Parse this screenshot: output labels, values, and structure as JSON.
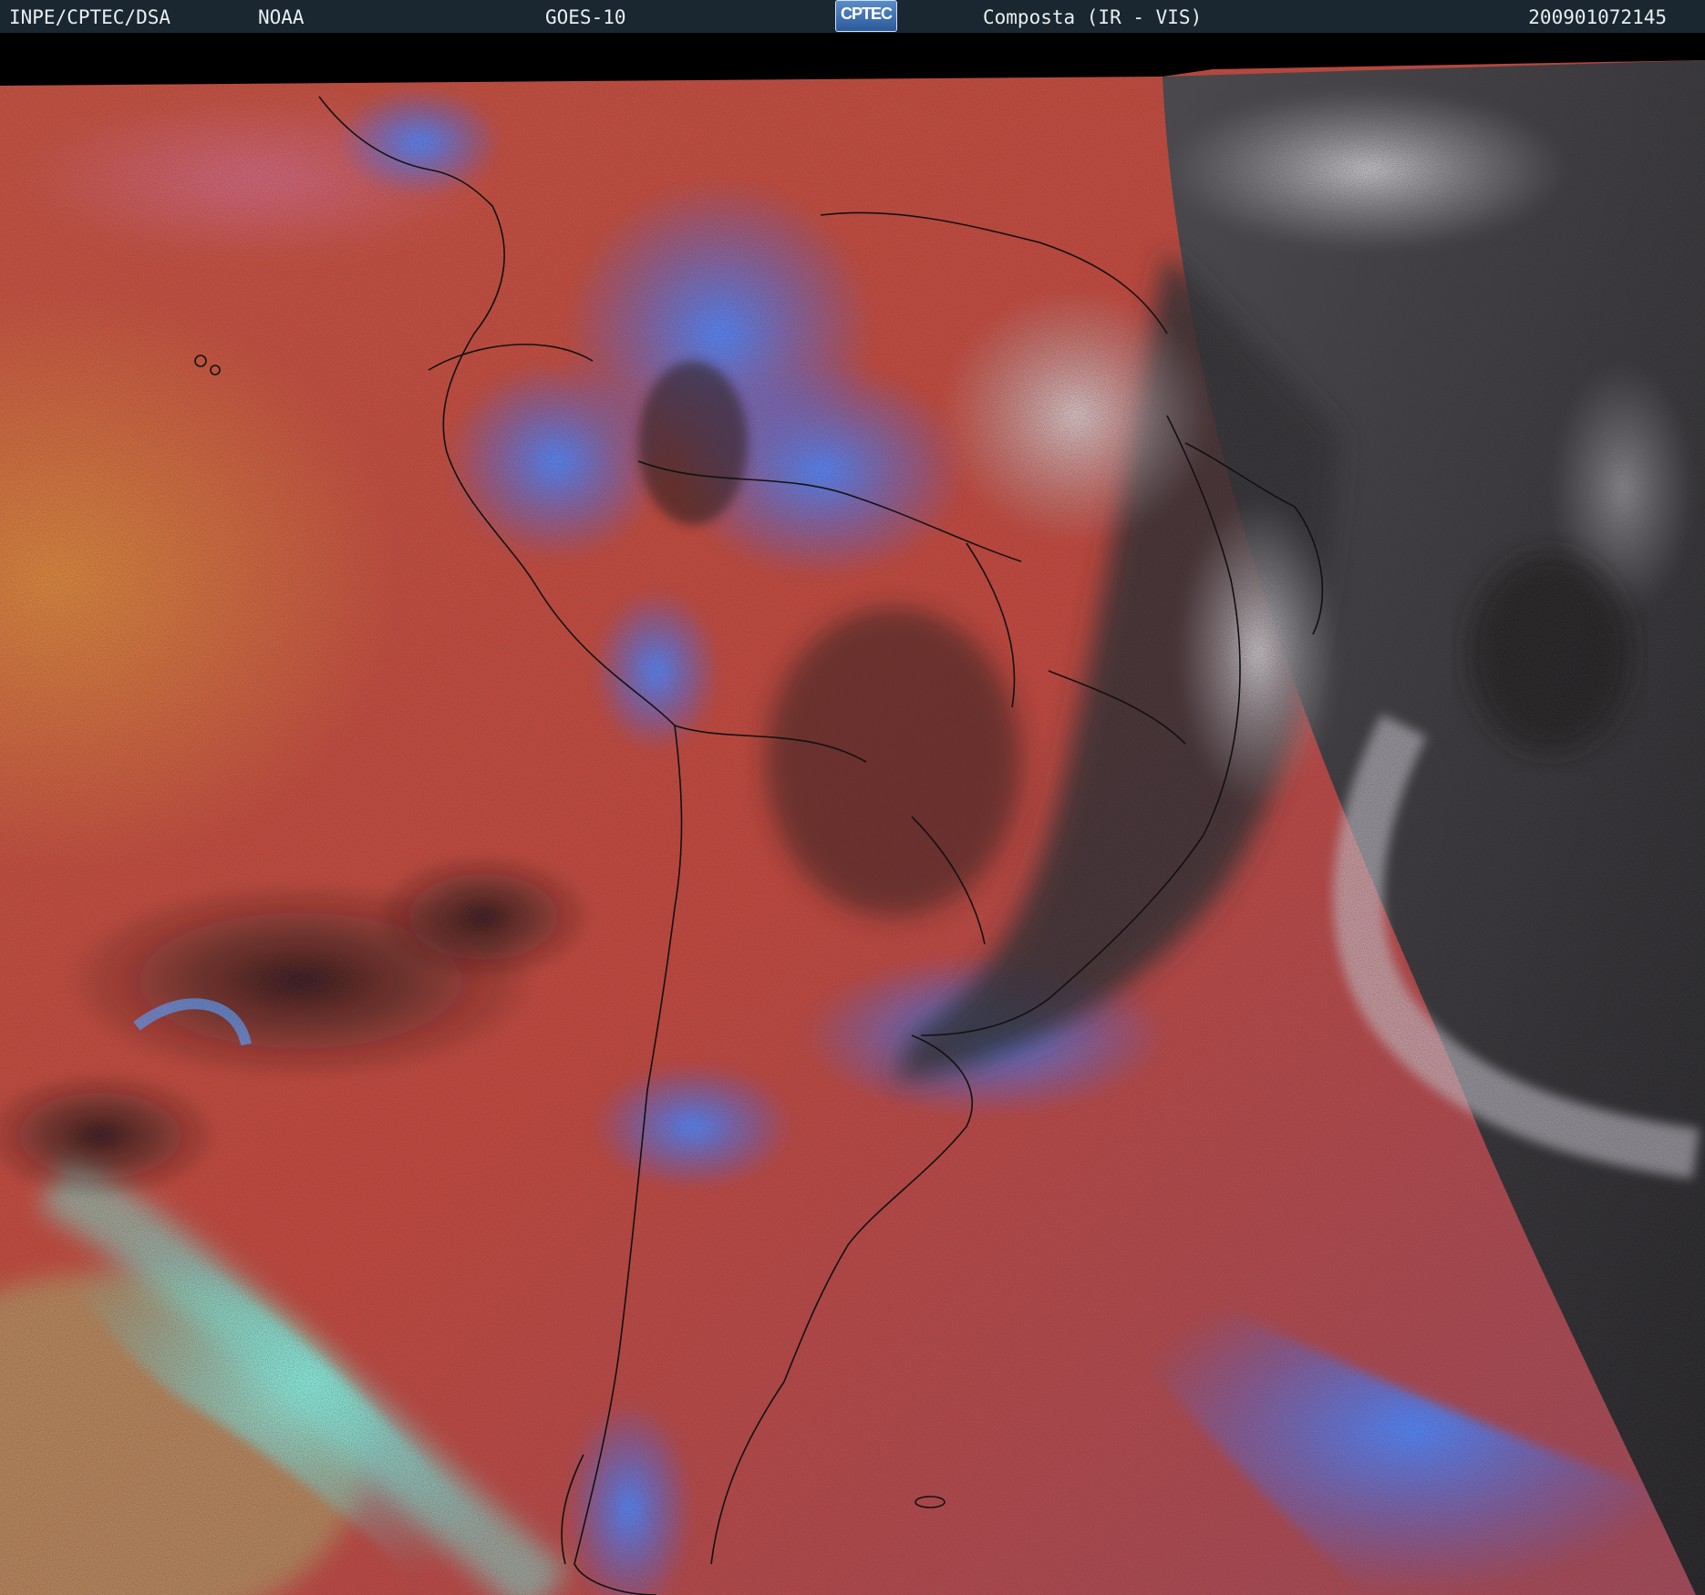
{
  "header": {
    "agency": "INPE/CPTEC/DSA",
    "source": "NOAA",
    "satellite": "GOES-10",
    "logo_text": "CPTEC",
    "product": "Composta (IR - VIS)",
    "timestamp": "200901072145"
  },
  "colors": {
    "header_bg": "#1b2730",
    "ocean_red": "#c8463a",
    "cloud_blue": "#3c78ff",
    "cloud_cyan": "#6ed2c8",
    "land_dark": "#2a1c1e",
    "vis_gray": "#2e3033",
    "vis_cloud": "#c8c8cc"
  }
}
